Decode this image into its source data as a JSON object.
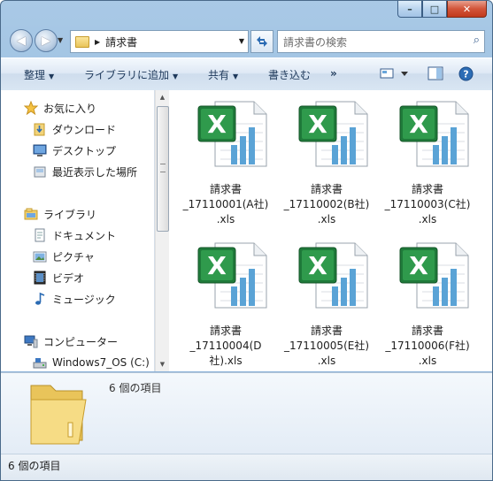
{
  "window": {
    "title": "請求書",
    "controls": {
      "minimize": "–",
      "maximize": "□",
      "close": "✕"
    }
  },
  "address": {
    "crumb": "請求書",
    "search_placeholder": "請求書の検索"
  },
  "toolbar": {
    "organize": "整理",
    "add_to_library": "ライブラリに追加",
    "share": "共有",
    "burn": "書き込む",
    "more": "»"
  },
  "sidebar": {
    "favorites": "お気に入り",
    "downloads": "ダウンロード",
    "desktop": "デスクトップ",
    "recent": "最近表示した場所",
    "libraries": "ライブラリ",
    "documents": "ドキュメント",
    "pictures": "ピクチャ",
    "videos": "ビデオ",
    "music": "ミュージック",
    "computer": "コンピューター",
    "drive_c": "Windows7_OS (C:)"
  },
  "files": [
    {
      "line1": "請求書",
      "line2": "_17110001(A社)",
      "line3": ".xls"
    },
    {
      "line1": "請求書",
      "line2": "_17110002(B社)",
      "line3": ".xls"
    },
    {
      "line1": "請求書",
      "line2": "_17110003(C社)",
      "line3": ".xls"
    },
    {
      "line1": "請求書",
      "line2": "_17110004(D",
      "line3": "社).xls"
    },
    {
      "line1": "請求書",
      "line2": "_17110005(E社)",
      "line3": ".xls"
    },
    {
      "line1": "請求書",
      "line2": "_17110006(F社)",
      "line3": ".xls"
    }
  ],
  "details": {
    "count": "6 個の項目"
  },
  "status": {
    "count": "6 個の項目"
  },
  "colors": {
    "excel_green": "#1f7a3a",
    "chart_blue": "#5aa3d6",
    "folder_yellow": "#f0cf6e"
  }
}
